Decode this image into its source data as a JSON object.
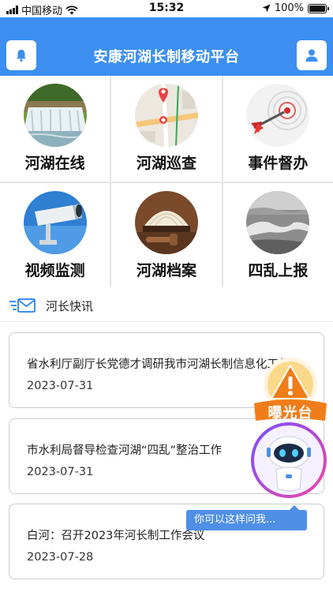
{
  "status_bar": {
    "carrier": "中国移动",
    "time": "15:32",
    "battery": "100%"
  },
  "header": {
    "title": "安康河湖长制移动平台"
  },
  "menu": [
    {
      "label": "河湖在线",
      "icon": "waterfall-photo"
    },
    {
      "label": "河湖巡查",
      "icon": "map-pin-photo"
    },
    {
      "label": "事件督办",
      "icon": "dart-target-photo"
    },
    {
      "label": "视频监测",
      "icon": "cctv-camera-photo"
    },
    {
      "label": "河湖档案",
      "icon": "law-book-gavel-photo"
    },
    {
      "label": "四乱上报",
      "icon": "river-aerial-photo"
    }
  ],
  "news": {
    "title": "河长快讯",
    "items": [
      {
        "text": "省水利厅副厅长党德才调研我市河湖长制信息化工作",
        "date": "2023-07-31"
      },
      {
        "text": "市水利局督导检查河湖“四乱”整治工作",
        "date": "2023-07-31"
      },
      {
        "text": "白河：召开2023年河长制工作会议",
        "date": "2023-07-28"
      }
    ]
  },
  "float": {
    "expose_label": "曝光台",
    "ask_hint": "你可以这样问我..."
  },
  "colors": {
    "header_bg": "#3c8ff0",
    "accent_orange": "#f07d1a",
    "bubble_bg": "#4f8fe6"
  }
}
